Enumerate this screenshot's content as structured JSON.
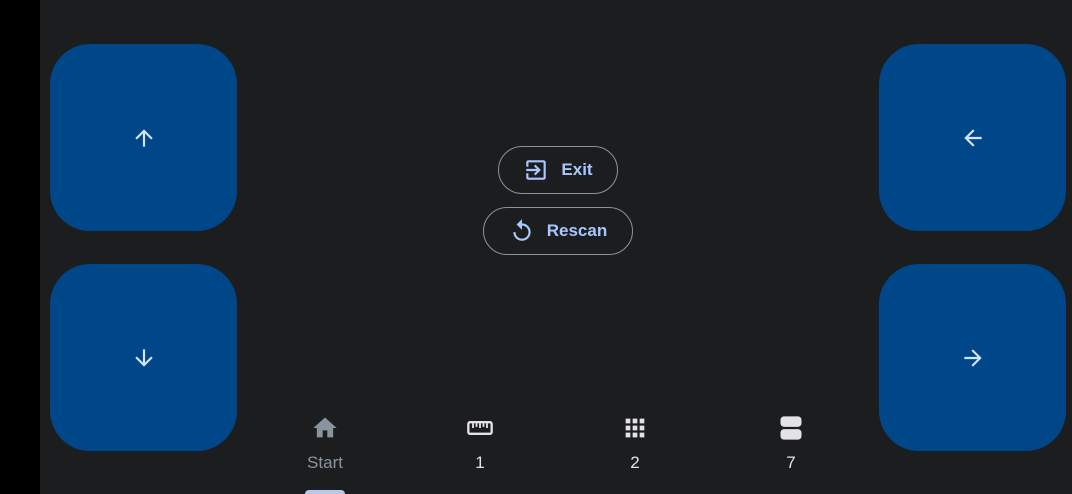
{
  "colors": {
    "background": "#1c1d1f",
    "side_bar": "#000000",
    "pad": "#00478a",
    "pad_icon": "#d6e3ff",
    "button_text": "#a9c7ff",
    "button_outline": "#8e9199",
    "nav_active_icon": "#8a949e",
    "nav_icon": "#e3e3e6"
  },
  "pads": {
    "up": {
      "icon": "arrow-up-icon"
    },
    "down": {
      "icon": "arrow-down-icon"
    },
    "left": {
      "icon": "arrow-left-icon"
    },
    "right": {
      "icon": "arrow-right-icon"
    }
  },
  "actions": {
    "exit": {
      "label": "Exit",
      "icon": "exit-icon"
    },
    "rescan": {
      "label": "Rescan",
      "icon": "rescan-icon"
    }
  },
  "nav": {
    "items": [
      {
        "label": "Start",
        "icon": "home-icon",
        "active": true
      },
      {
        "label": "1",
        "icon": "ruler-icon",
        "active": false
      },
      {
        "label": "2",
        "icon": "grid-icon",
        "active": false
      },
      {
        "label": "7",
        "icon": "rows-icon",
        "active": false
      }
    ]
  }
}
